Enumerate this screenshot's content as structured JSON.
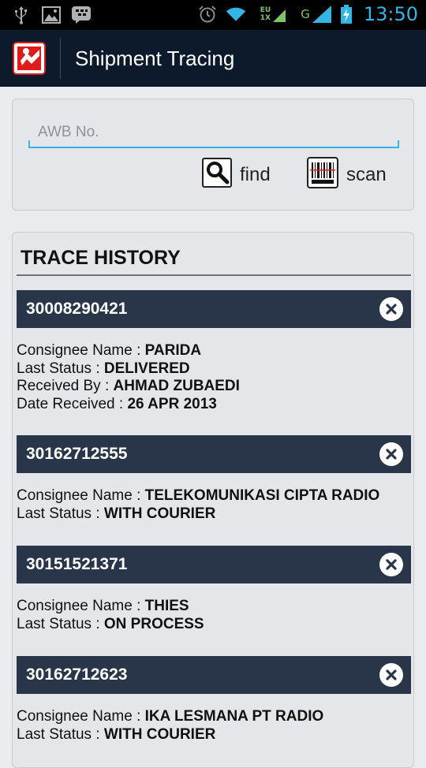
{
  "status_bar": {
    "time": "13:50",
    "network_top": "EU",
    "network_bottom": "1X",
    "network_type": "G",
    "icons": [
      "usb-icon",
      "image-icon",
      "bbm-icon",
      "alarm-icon",
      "wifi-icon",
      "signal-icon",
      "battery-charging-icon"
    ]
  },
  "app": {
    "title": "Shipment Tracing",
    "logo_icon": "app-logo-icon",
    "accent": "#33b5e5",
    "header_bg": "#0d1a2b",
    "entry_header_bg": "#293549"
  },
  "search": {
    "placeholder": "AWB No.",
    "value": "",
    "find_label": "find",
    "scan_label": "scan"
  },
  "history": {
    "title": "TRACE HISTORY",
    "entries": [
      {
        "awb": "30008290421",
        "fields": [
          {
            "label": "Consignee Name : ",
            "value": "PARIDA"
          },
          {
            "label": "Last Status : ",
            "value": "DELIVERED"
          },
          {
            "label": "Received By : ",
            "value": "AHMAD ZUBAEDI"
          },
          {
            "label": "Date Received : ",
            "value": "26 APR 2013"
          }
        ]
      },
      {
        "awb": "30162712555",
        "fields": [
          {
            "label": "Consignee Name : ",
            "value": "TELEKOMUNIKASI CIPTA RADIO"
          },
          {
            "label": "Last Status : ",
            "value": "WITH COURIER"
          }
        ]
      },
      {
        "awb": "30151521371",
        "fields": [
          {
            "label": "Consignee Name : ",
            "value": "THIES"
          },
          {
            "label": "Last Status : ",
            "value": "ON PROCESS"
          }
        ]
      },
      {
        "awb": "30162712623",
        "fields": [
          {
            "label": "Consignee Name : ",
            "value": "IKA LESMANA PT RADIO"
          },
          {
            "label": "Last Status : ",
            "value": "WITH COURIER"
          }
        ]
      }
    ]
  }
}
